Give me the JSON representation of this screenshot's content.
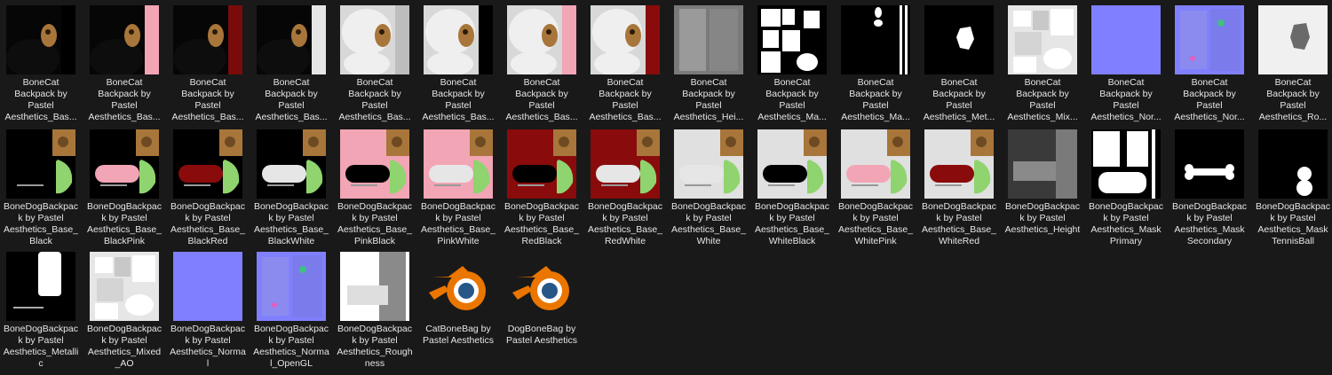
{
  "row1": [
    {
      "label": "BoneCat Backpack by Pastel Aesthetics_Bas...",
      "style": "cat",
      "bg": "#060606",
      "strip": "#000000"
    },
    {
      "label": "BoneCat Backpack by Pastel Aesthetics_Bas...",
      "style": "cat",
      "bg": "#060606",
      "strip": "#f2a5b5"
    },
    {
      "label": "BoneCat Backpack by Pastel Aesthetics_Bas...",
      "style": "cat",
      "bg": "#060606",
      "strip": "#7a0b0b"
    },
    {
      "label": "BoneCat Backpack by Pastel Aesthetics_Bas...",
      "style": "cat",
      "bg": "#060606",
      "strip": "#e6e6e6"
    },
    {
      "label": "BoneCat Backpack by Pastel Aesthetics_Bas...",
      "style": "catlight",
      "bg": "#d8d8d8",
      "strip": "#bdbdbd"
    },
    {
      "label": "BoneCat Backpack by Pastel Aesthetics_Bas...",
      "style": "catlight",
      "bg": "#d8d8d8",
      "strip": "#000000"
    },
    {
      "label": "BoneCat Backpack by Pastel Aesthetics_Bas...",
      "style": "catlight",
      "bg": "#d8d8d8",
      "strip": "#f2a5b5"
    },
    {
      "label": "BoneCat Backpack by Pastel Aesthetics_Bas...",
      "style": "catlight",
      "bg": "#d8d8d8",
      "strip": "#8a0b0b"
    },
    {
      "label": "BoneCat Backpack by Pastel Aesthetics_Hei...",
      "style": "height",
      "bg": "#7a7a7a",
      "strip": "#8c8c8c"
    },
    {
      "label": "BoneCat Backpack by Pastel Aesthetics_Ma...",
      "style": "mask",
      "bg": "#000000",
      "strip": "#ffffff"
    },
    {
      "label": "BoneCat Backpack by Pastel Aesthetics_Ma...",
      "style": "mask2",
      "bg": "#000000",
      "strip": "#ffffff"
    },
    {
      "label": "BoneCat Backpack by Pastel Aesthetics_Met...",
      "style": "metal",
      "bg": "#000000",
      "strip": "#000000"
    },
    {
      "label": "BoneCat Backpack by Pastel Aesthetics_Mix...",
      "style": "mixed",
      "bg": "#e6e6e6",
      "strip": "#000000"
    },
    {
      "label": "BoneCat Backpack by Pastel Aesthetics_Nor...",
      "style": "flat",
      "bg": "#7f7fff",
      "strip": "#7f7fff"
    },
    {
      "label": "BoneCat Backpack by Pastel Aesthetics_Nor...",
      "style": "normal",
      "bg": "#8080ff",
      "strip": "#8080ff"
    },
    {
      "label": "BoneCat Backpack by Pastel Aesthetics_Ro...",
      "style": "rough",
      "bg": "#f0f0f0",
      "strip": "#f0f0f0"
    }
  ],
  "row2": [
    {
      "label": "BoneDogBackpack by Pastel Aesthetics_Base_Black",
      "style": "dog",
      "bg": "#000000",
      "strip": "#000000"
    },
    {
      "label": "BoneDogBackpack by Pastel Aesthetics_Base_BlackPink",
      "style": "dog",
      "bg": "#000000",
      "strip": "#f2a5b5"
    },
    {
      "label": "BoneDogBackpack by Pastel Aesthetics_Base_BlackRed",
      "style": "dog",
      "bg": "#000000",
      "strip": "#8a0b0b"
    },
    {
      "label": "BoneDogBackpack by Pastel Aesthetics_Base_BlackWhite",
      "style": "dog",
      "bg": "#000000",
      "strip": "#e6e6e6"
    },
    {
      "label": "BoneDogBackpack by Pastel Aesthetics_Base_PinkBlack",
      "style": "dog",
      "bg": "#f2a5b5",
      "strip": "#000000"
    },
    {
      "label": "BoneDogBackpack by Pastel Aesthetics_Base_PinkWhite",
      "style": "dog",
      "bg": "#f2a5b5",
      "strip": "#e6e6e6"
    },
    {
      "label": "BoneDogBackpack by Pastel Aesthetics_Base_RedBlack",
      "style": "dog",
      "bg": "#8a0b0b",
      "strip": "#000000"
    },
    {
      "label": "BoneDogBackpack by Pastel Aesthetics_Base_RedWhite",
      "style": "dog",
      "bg": "#8a0b0b",
      "strip": "#e6e6e6"
    },
    {
      "label": "BoneDogBackpack by Pastel Aesthetics_Base_White",
      "style": "dog",
      "bg": "#e0e0e0",
      "strip": "#e6e6e6"
    },
    {
      "label": "BoneDogBackpack by Pastel Aesthetics_Base_WhiteBlack",
      "style": "dog",
      "bg": "#e0e0e0",
      "strip": "#000000"
    },
    {
      "label": "BoneDogBackpack by Pastel Aesthetics_Base_WhitePink",
      "style": "dog",
      "bg": "#e0e0e0",
      "strip": "#f2a5b5"
    },
    {
      "label": "BoneDogBackpack by Pastel Aesthetics_Base_WhiteRed",
      "style": "dog",
      "bg": "#e0e0e0",
      "strip": "#8a0b0b"
    },
    {
      "label": "BoneDogBackpack by Pastel Aesthetics_Height",
      "style": "dogheight",
      "bg": "#6a6a6a",
      "strip": "#8a8a8a"
    },
    {
      "label": "BoneDogBackpack by Pastel Aesthetics_Mask Primary",
      "style": "dogmask",
      "bg": "#000000",
      "strip": "#ffffff"
    },
    {
      "label": "BoneDogBackpack by Pastel Aesthetics_Mask Secondary",
      "style": "bone",
      "bg": "#000000",
      "strip": "#000000"
    },
    {
      "label": "BoneDogBackpack by Pastel Aesthetics_Mask TennisBall",
      "style": "tennis",
      "bg": "#000000",
      "strip": "#000000"
    }
  ],
  "row3": [
    {
      "label": "BoneDogBackpack by Pastel Aesthetics_Metallic",
      "style": "dogmetal",
      "bg": "#000000",
      "strip": "#000000"
    },
    {
      "label": "BoneDogBackpack by Pastel Aesthetics_Mixed_AO",
      "style": "mixed",
      "bg": "#e6e6e6",
      "strip": "#000000"
    },
    {
      "label": "BoneDogBackpack by Pastel Aesthetics_Normal",
      "style": "flat",
      "bg": "#7f7fff",
      "strip": "#7f7fff"
    },
    {
      "label": "BoneDogBackpack by Pastel Aesthetics_Normal_OpenGL",
      "style": "normal",
      "bg": "#8080ff",
      "strip": "#8080ff"
    },
    {
      "label": "BoneDogBackpack by Pastel Aesthetics_Roughness",
      "style": "dogrough",
      "bg": "#ffffff",
      "strip": "#8a8a8a"
    },
    {
      "label": "CatBoneBag by Pastel Aesthetics",
      "style": "blender",
      "bg": "#191919",
      "strip": "#191919"
    },
    {
      "label": "DogBoneBag by Pastel Aesthetics",
      "style": "blender",
      "bg": "#191919",
      "strip": "#191919"
    }
  ]
}
